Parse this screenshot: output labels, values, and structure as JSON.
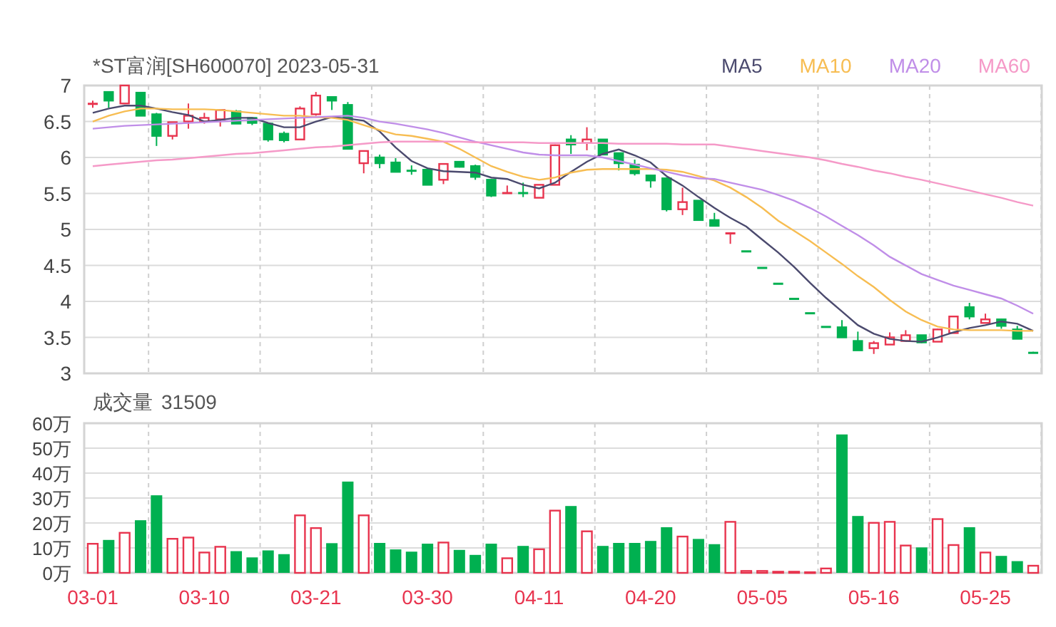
{
  "header": {
    "title": "*ST富润[SH600070] 2023-05-31"
  },
  "price_chart": {
    "chart_data": {
      "type": "candlestick",
      "grid": true,
      "ylim": [
        3,
        7
      ],
      "yticks": [
        7,
        6.5,
        6,
        5.5,
        5,
        4.5,
        4,
        3.5,
        3
      ],
      "series": [
        {
          "name": "MA5",
          "type": "line",
          "color": "#4b4a6e",
          "values": [
            6.62,
            6.68,
            6.72,
            6.72,
            6.68,
            6.63,
            6.59,
            6.5,
            6.52,
            6.55,
            6.55,
            6.48,
            6.42,
            6.42,
            6.5,
            6.56,
            6.54,
            6.51,
            6.36,
            6.14,
            5.95,
            5.85,
            5.81,
            5.8,
            5.79,
            5.72,
            5.7,
            5.62,
            5.57,
            5.65,
            5.8,
            5.94,
            6.05,
            6.11,
            6.03,
            5.93,
            5.74,
            5.61,
            5.45,
            5.3,
            5.16,
            5.04,
            4.86,
            4.68,
            4.48,
            4.26,
            4.05,
            3.86,
            3.67,
            3.55,
            3.48,
            3.45,
            3.44,
            3.5,
            3.57,
            3.63,
            3.67,
            3.72,
            3.69,
            3.59
          ]
        },
        {
          "name": "MA10",
          "type": "line",
          "color": "#f7bd52",
          "values": [
            6.5,
            6.58,
            6.64,
            6.68,
            6.68,
            6.67,
            6.67,
            6.67,
            6.66,
            6.64,
            6.62,
            6.6,
            6.58,
            6.58,
            6.56,
            6.55,
            6.52,
            6.45,
            6.38,
            6.32,
            6.3,
            6.26,
            6.22,
            6.12,
            6.0,
            5.88,
            5.8,
            5.73,
            5.69,
            5.72,
            5.79,
            5.83,
            5.84,
            5.84,
            5.84,
            5.84,
            5.83,
            5.8,
            5.74,
            5.68,
            5.58,
            5.45,
            5.3,
            5.12,
            4.98,
            4.84,
            4.68,
            4.52,
            4.35,
            4.2,
            4.02,
            3.86,
            3.74,
            3.65,
            3.61,
            3.6,
            3.6,
            3.6,
            3.59,
            3.59
          ]
        },
        {
          "name": "MA20",
          "type": "line",
          "color": "#c08ee8",
          "values": [
            6.4,
            6.42,
            6.44,
            6.45,
            6.46,
            6.47,
            6.48,
            6.49,
            6.5,
            6.51,
            6.52,
            6.53,
            6.54,
            6.55,
            6.56,
            6.57,
            6.58,
            6.55,
            6.5,
            6.47,
            6.43,
            6.39,
            6.34,
            6.28,
            6.22,
            6.17,
            6.12,
            6.07,
            6.04,
            6.03,
            6.03,
            6.03,
            6.0,
            5.95,
            5.9,
            5.85,
            5.8,
            5.75,
            5.71,
            5.7,
            5.65,
            5.6,
            5.55,
            5.48,
            5.4,
            5.3,
            5.18,
            5.05,
            4.92,
            4.78,
            4.62,
            4.5,
            4.38,
            4.3,
            4.22,
            4.16,
            4.1,
            4.04,
            3.94,
            3.83
          ]
        },
        {
          "name": "MA60",
          "type": "line",
          "color": "#f59ac8",
          "values": [
            5.88,
            5.9,
            5.92,
            5.94,
            5.96,
            5.97,
            5.99,
            6.01,
            6.03,
            6.05,
            6.06,
            6.08,
            6.1,
            6.12,
            6.14,
            6.15,
            6.17,
            6.19,
            6.21,
            6.22,
            6.22,
            6.22,
            6.22,
            6.22,
            6.21,
            6.21,
            6.21,
            6.21,
            6.2,
            6.2,
            6.2,
            6.2,
            6.2,
            6.19,
            6.19,
            6.19,
            6.19,
            6.18,
            6.18,
            6.18,
            6.15,
            6.12,
            6.09,
            6.06,
            6.03,
            6.0,
            5.96,
            5.91,
            5.87,
            5.82,
            5.78,
            5.73,
            5.69,
            5.64,
            5.59,
            5.54,
            5.49,
            5.44,
            5.38,
            5.33
          ]
        }
      ],
      "ohlc": [
        [
          6.74,
          6.79,
          6.69,
          6.75
        ],
        [
          6.91,
          6.91,
          6.69,
          6.79
        ],
        [
          6.75,
          7.0,
          6.75,
          7.0
        ],
        [
          6.9,
          6.9,
          6.58,
          6.58
        ],
        [
          6.6,
          6.62,
          6.16,
          6.3
        ],
        [
          6.3,
          6.49,
          6.25,
          6.49
        ],
        [
          6.5,
          6.75,
          6.4,
          6.58
        ],
        [
          6.5,
          6.62,
          6.47,
          6.55
        ],
        [
          6.53,
          6.66,
          6.43,
          6.66
        ],
        [
          6.64,
          6.66,
          6.47,
          6.47
        ],
        [
          6.55,
          6.55,
          6.45,
          6.48
        ],
        [
          6.47,
          6.48,
          6.22,
          6.25
        ],
        [
          6.33,
          6.36,
          6.21,
          6.24
        ],
        [
          6.25,
          6.71,
          6.25,
          6.68
        ],
        [
          6.6,
          6.91,
          6.58,
          6.86
        ],
        [
          6.84,
          6.84,
          6.66,
          6.79
        ],
        [
          6.73,
          6.77,
          6.12,
          6.12
        ],
        [
          5.92,
          6.09,
          5.78,
          6.09
        ],
        [
          6.0,
          6.04,
          5.85,
          5.92
        ],
        [
          5.93,
          5.99,
          5.8,
          5.8
        ],
        [
          5.82,
          5.89,
          5.76,
          5.81
        ],
        [
          5.83,
          5.84,
          5.62,
          5.62
        ],
        [
          5.69,
          5.92,
          5.63,
          5.91
        ],
        [
          5.94,
          5.95,
          5.86,
          5.87
        ],
        [
          5.88,
          5.9,
          5.69,
          5.73
        ],
        [
          5.69,
          5.7,
          5.45,
          5.47
        ],
        [
          5.5,
          5.61,
          5.5,
          5.51
        ],
        [
          5.51,
          5.65,
          5.45,
          5.5
        ],
        [
          5.44,
          5.62,
          5.44,
          5.62
        ],
        [
          5.62,
          6.18,
          5.62,
          6.17
        ],
        [
          6.25,
          6.31,
          6.05,
          6.18
        ],
        [
          6.2,
          6.42,
          6.1,
          6.25
        ],
        [
          6.25,
          6.25,
          6.04,
          6.04
        ],
        [
          6.06,
          6.06,
          5.82,
          5.92
        ],
        [
          5.9,
          5.97,
          5.75,
          5.78
        ],
        [
          5.75,
          5.76,
          5.58,
          5.68
        ],
        [
          5.71,
          5.72,
          5.25,
          5.28
        ],
        [
          5.28,
          5.58,
          5.2,
          5.38
        ],
        [
          5.4,
          5.4,
          5.13,
          5.13
        ],
        [
          5.13,
          5.23,
          5.05,
          5.05
        ],
        [
          4.94,
          4.96,
          4.8,
          4.95
        ],
        [
          4.7,
          4.7,
          4.7,
          4.7
        ],
        [
          4.47,
          4.47,
          4.47,
          4.47
        ],
        [
          4.25,
          4.25,
          4.25,
          4.25
        ],
        [
          4.04,
          4.04,
          4.04,
          4.04
        ],
        [
          3.84,
          3.84,
          3.84,
          3.84
        ],
        [
          3.65,
          3.65,
          3.65,
          3.65
        ],
        [
          3.64,
          3.74,
          3.5,
          3.5
        ],
        [
          3.45,
          3.58,
          3.32,
          3.32
        ],
        [
          3.35,
          3.45,
          3.27,
          3.42
        ],
        [
          3.4,
          3.57,
          3.4,
          3.5
        ],
        [
          3.45,
          3.6,
          3.45,
          3.53
        ],
        [
          3.53,
          3.53,
          3.42,
          3.43
        ],
        [
          3.44,
          3.62,
          3.44,
          3.61
        ],
        [
          3.56,
          3.79,
          3.56,
          3.79
        ],
        [
          3.92,
          3.98,
          3.75,
          3.79
        ],
        [
          3.7,
          3.83,
          3.7,
          3.75
        ],
        [
          3.75,
          3.76,
          3.62,
          3.66
        ],
        [
          3.61,
          3.66,
          3.48,
          3.48
        ],
        [
          3.29,
          3.3,
          3.28,
          3.29
        ]
      ]
    }
  },
  "volume_chart": {
    "label": "成交量",
    "value": "31509",
    "chart_data": {
      "type": "bar",
      "grid": true,
      "ylim": [
        0,
        60
      ],
      "yticks": [
        {
          "value": 60,
          "label": "60万"
        },
        {
          "value": 50,
          "label": "50万"
        },
        {
          "value": 40,
          "label": "40万"
        },
        {
          "value": 30,
          "label": "30万"
        },
        {
          "value": 20,
          "label": "20万"
        },
        {
          "value": 10,
          "label": "10万"
        },
        {
          "value": 0,
          "label": "0万"
        }
      ],
      "categories": [
        "03-01",
        null,
        null,
        null,
        null,
        null,
        null,
        "03-10",
        null,
        null,
        null,
        null,
        null,
        null,
        "03-21",
        null,
        null,
        null,
        null,
        null,
        null,
        "03-30",
        null,
        null,
        null,
        null,
        null,
        null,
        "04-11",
        null,
        null,
        null,
        null,
        null,
        null,
        "04-20",
        null,
        null,
        null,
        null,
        null,
        null,
        "05-05",
        null,
        null,
        null,
        null,
        null,
        null,
        "05-16",
        null,
        null,
        null,
        null,
        null,
        null,
        "05-25",
        null,
        null,
        null
      ],
      "values": [
        12,
        13.2,
        16.4,
        21.1,
        31.1,
        14,
        14.5,
        8.5,
        10.8,
        8.7,
        6.2,
        9,
        7.5,
        23.4,
        18.3,
        11.9,
        36.6,
        23.4,
        12,
        9.4,
        8.5,
        11.7,
        12.5,
        9.2,
        7.2,
        11.7,
        6.2,
        10.8,
        9.8,
        25.3,
        26.8,
        17,
        10.8,
        12,
        12,
        12.8,
        18.3,
        14.9,
        13.6,
        11.5,
        20.8,
        1.1,
        1.1,
        0.8,
        0.8,
        0.6,
        2.1,
        55.5,
        22.8,
        20.4,
        20.8,
        11.3,
        10.2,
        21.9,
        11.5,
        18.3,
        8.5,
        6.8,
        4.7,
        3.2
      ]
    }
  }
}
